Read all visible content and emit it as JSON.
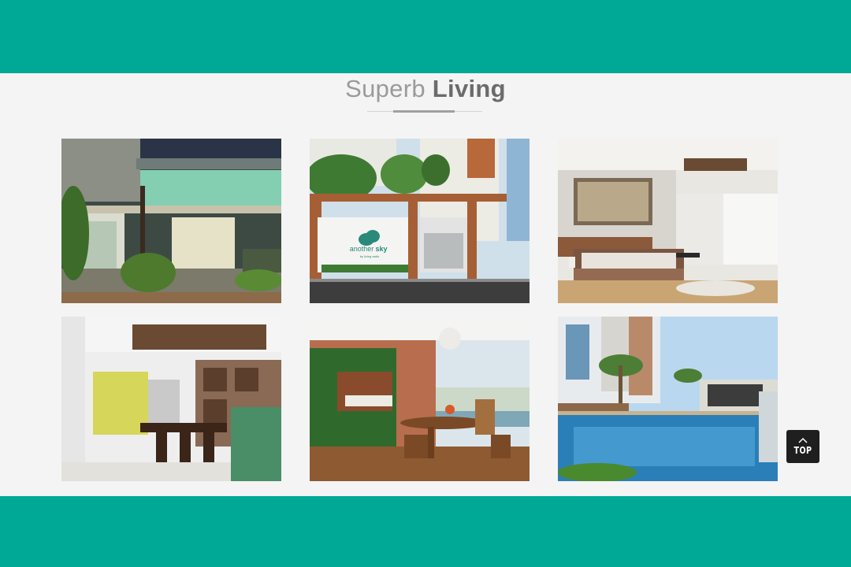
{
  "section": {
    "title_light": "Superb",
    "title_bold": "Living"
  },
  "gallery": {
    "items": [
      {
        "subject": "exterior-night"
      },
      {
        "subject": "entrance-sign",
        "sign_text_1": "another",
        "sign_text_2": "sky",
        "sign_text_3": "by living walls"
      },
      {
        "subject": "bedroom"
      },
      {
        "subject": "dining-room"
      },
      {
        "subject": "balcony"
      },
      {
        "subject": "swimming-pool"
      }
    ]
  },
  "back_to_top": {
    "label": "TOP",
    "icon": "chevron-up-icon"
  },
  "colors": {
    "teal_band": "#00a896",
    "page_background": "#f4f4f4",
    "button_background": "#1f1f1f"
  }
}
